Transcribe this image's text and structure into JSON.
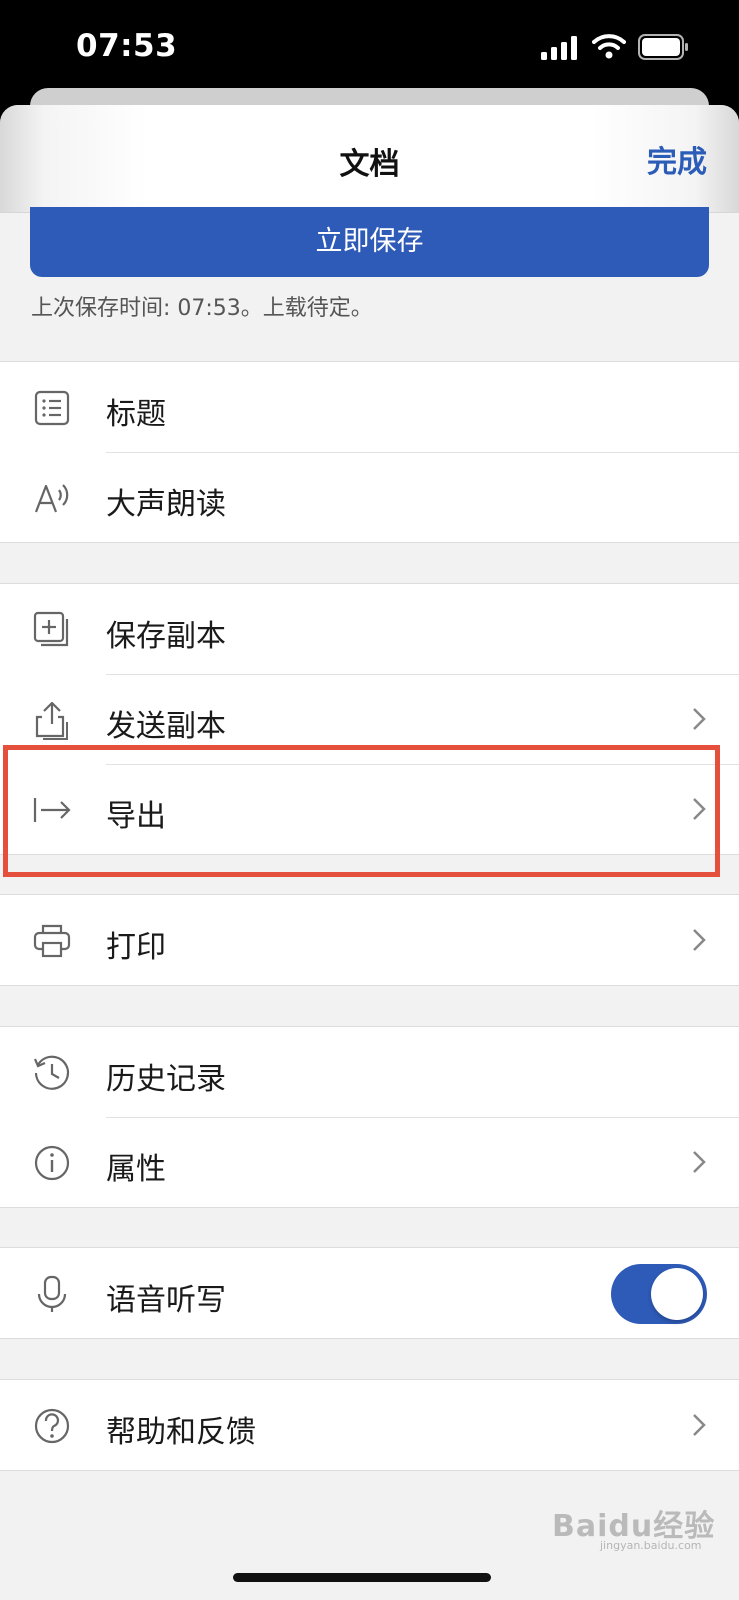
{
  "status_bar": {
    "time": "07:53"
  },
  "header": {
    "title": "文档",
    "done_label": "完成"
  },
  "save": {
    "button_label": "立即保存",
    "status_text": "上次保存时间: 07:53。上载待定。"
  },
  "groups": [
    {
      "items": [
        {
          "label": "标题",
          "icon": "list-icon"
        },
        {
          "label": "大声朗读",
          "icon": "read-aloud-icon"
        }
      ]
    },
    {
      "items": [
        {
          "label": "保存副本",
          "icon": "save-copy-icon"
        },
        {
          "label": "发送副本",
          "icon": "share-icon",
          "chevron": true
        },
        {
          "label": "导出",
          "icon": "export-icon",
          "chevron": true,
          "highlighted": true
        }
      ]
    },
    {
      "items": [
        {
          "label": "打印",
          "icon": "print-icon",
          "chevron": true
        }
      ]
    },
    {
      "items": [
        {
          "label": "历史记录",
          "icon": "history-icon"
        },
        {
          "label": "属性",
          "icon": "info-icon",
          "chevron": true
        }
      ]
    },
    {
      "items": [
        {
          "label": "语音听写",
          "icon": "microphone-icon",
          "toggle": true,
          "toggle_on": true
        }
      ]
    },
    {
      "items": [
        {
          "label": "帮助和反馈",
          "icon": "help-icon",
          "chevron": true
        }
      ]
    }
  ],
  "colors": {
    "accent": "#2e5bb8",
    "highlight": "#e4503c"
  },
  "watermark": {
    "text": "Baidu经验",
    "sub": "jingyan.baidu.com"
  }
}
